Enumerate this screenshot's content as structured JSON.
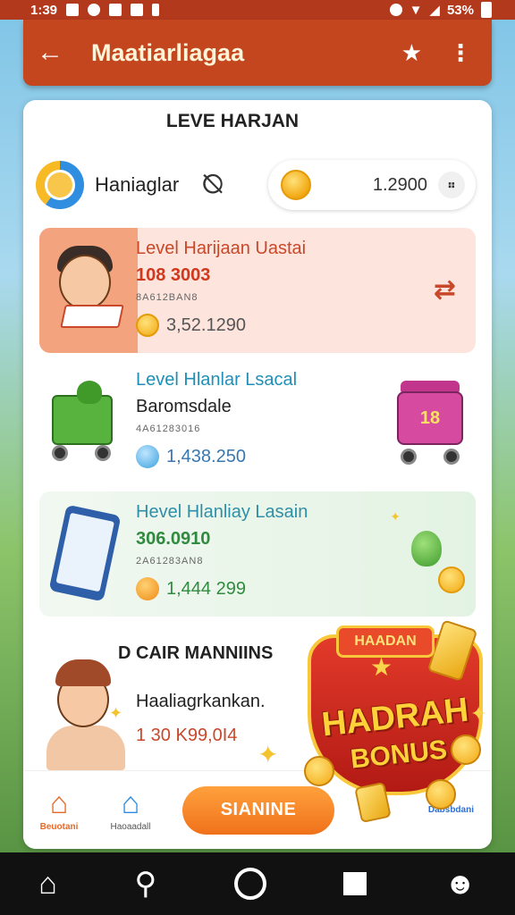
{
  "status_bar": {
    "time": "1:39",
    "battery": "53%"
  },
  "app_bar": {
    "title": "Maatiarliagaa"
  },
  "card": {
    "title": "LEVE HARJAN"
  },
  "balance": {
    "name": "Haniaglar",
    "coin_value": "1.2900"
  },
  "items": [
    {
      "title": "Level Harijaan Uastai",
      "subtitle": "108 3003",
      "tiny": "8A612BAN8",
      "amount": "3,52.1290"
    },
    {
      "title": "Level Hlanlar Lsacal",
      "subtitle": "Baromsdale",
      "tiny": "4A61283016",
      "amount": "1,438.250",
      "cart_label": "18"
    },
    {
      "title": "Hevel Hlanliay Lasain",
      "subtitle": "306.0910",
      "tiny": "2A61283AN8",
      "amount": "1,444 299"
    }
  ],
  "bonus": {
    "heading": "D CAIR MANNIINS",
    "description": "Haaliagrkankan.",
    "amount": "1 30 K99,0I4",
    "badge_top": "HAADAN",
    "badge_title": "HADRAH",
    "badge_sub": "BONUS"
  },
  "bottom_nav": {
    "home_label": "Beuotani",
    "house_label": "Haoaadall",
    "signin_label": "SIANINE",
    "right_label": "Dabsbdani"
  },
  "icons": [
    "back-arrow-icon",
    "star-icon",
    "more-icon",
    "compass-icon",
    "dots-icon",
    "home-icon",
    "house-icon",
    "sys-home-icon",
    "sys-search-icon",
    "sys-recent-icon",
    "sys-people-icon"
  ]
}
